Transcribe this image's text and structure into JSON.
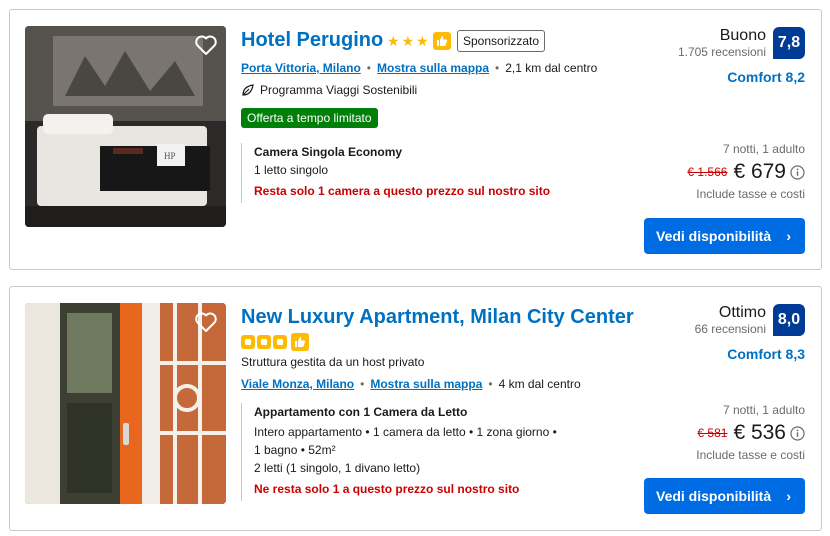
{
  "listings": [
    {
      "title": "Hotel Perugino",
      "sponsored": "Sponsorizzato",
      "location": "Porta Vittoria, Milano",
      "map_link": "Mostra sulla mappa",
      "distance": "2,1 km dal centro",
      "eco": "Programma Viaggi Sostenibili",
      "deal": "Offerta a tempo limitato",
      "room_name": "Camera Singola Economy",
      "room_lines": [
        "1 letto singolo"
      ],
      "warning": "Resta solo 1 camera a questo prezzo sul nostro sito",
      "score_word": "Buono",
      "reviews": "1.705 recensioni",
      "score": "7,8",
      "comfort": "Comfort 8,2",
      "nights": "7 notti, 1 adulto",
      "old_price": "€ 1.566",
      "price": "€ 679",
      "taxes": "Include tasse e costi",
      "button": "Vedi disponibilità",
      "star_count": 3
    },
    {
      "title": "New Luxury Apartment, Milan City Center",
      "host": "Struttura gestita da un host privato",
      "location": "Viale Monza, Milano",
      "map_link": "Mostra sulla mappa",
      "distance": "4 km dal centro",
      "room_name": "Appartamento con 1 Camera da Letto",
      "room_lines": [
        "Intero appartamento • 1 camera da letto • 1 zona giorno •",
        "1 bagno • 52m²",
        "2 letti (1 singolo, 1 divano letto)"
      ],
      "warning": "Ne resta solo 1 a questo prezzo sul nostro sito",
      "score_word": "Ottimo",
      "reviews": "66 recensioni",
      "score": "8,0",
      "comfort": "Comfort 8,3",
      "nights": "7 notti, 1 adulto",
      "old_price": "€ 581",
      "price": "€ 536",
      "taxes": "Include tasse e costi",
      "button": "Vedi disponibilità",
      "square_count": 3
    }
  ],
  "colors": {
    "link": "#0071c2",
    "badge": "#003b95",
    "button": "#006ce4",
    "deal": "#008009",
    "warning": "#cc0000",
    "star": "#febb02"
  },
  "icons": [
    "heart-icon",
    "star-icon",
    "thumbs-up-icon",
    "leaf-icon",
    "info-icon",
    "chevron-right-icon"
  ]
}
